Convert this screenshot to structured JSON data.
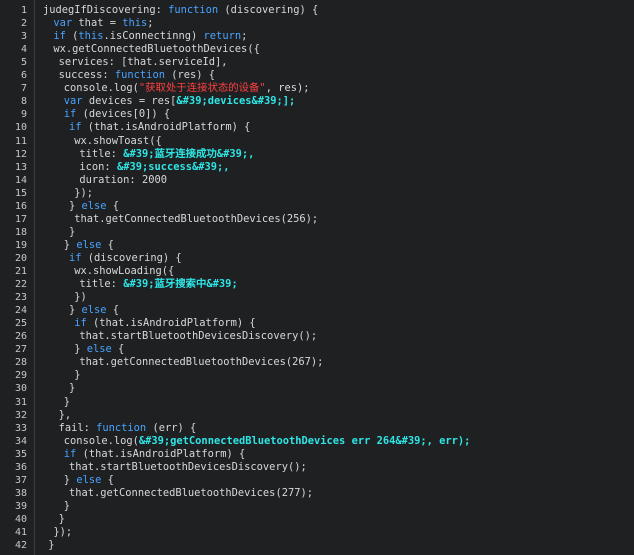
{
  "lines": [
    {
      "n": "1",
      "indent": 0,
      "parts": [
        {
          "t": "judegIfDiscovering: ",
          "c": "txt"
        },
        {
          "t": "function",
          "c": "kw"
        },
        {
          "t": " (discovering) {",
          "c": "txt"
        }
      ]
    },
    {
      "n": "2",
      "indent": 2,
      "parts": [
        {
          "t": "var",
          "c": "kw"
        },
        {
          "t": " that = ",
          "c": "txt"
        },
        {
          "t": "this",
          "c": "kw"
        },
        {
          "t": ";",
          "c": "txt"
        }
      ]
    },
    {
      "n": "3",
      "indent": 2,
      "parts": [
        {
          "t": "if",
          "c": "kw"
        },
        {
          "t": " (",
          "c": "txt"
        },
        {
          "t": "this",
          "c": "kw"
        },
        {
          "t": ".isConnectinng) ",
          "c": "txt"
        },
        {
          "t": "return",
          "c": "kw"
        },
        {
          "t": ";",
          "c": "txt"
        }
      ]
    },
    {
      "n": "4",
      "indent": 2,
      "parts": [
        {
          "t": "wx.getConnectedBluetoothDevices({",
          "c": "txt"
        }
      ]
    },
    {
      "n": "5",
      "indent": 3,
      "parts": [
        {
          "t": "services: [that.serviceId],",
          "c": "txt"
        }
      ]
    },
    {
      "n": "6",
      "indent": 3,
      "parts": [
        {
          "t": "success: ",
          "c": "txt"
        },
        {
          "t": "function",
          "c": "kw"
        },
        {
          "t": " (res) {",
          "c": "txt"
        }
      ]
    },
    {
      "n": "7",
      "indent": 4,
      "parts": [
        {
          "t": "console.log(",
          "c": "txt"
        },
        {
          "t": "\"获取处于连接状态的设备\"",
          "c": "str"
        },
        {
          "t": ", res);",
          "c": "txt"
        }
      ]
    },
    {
      "n": "8",
      "indent": 4,
      "parts": [
        {
          "t": "var",
          "c": "kw"
        },
        {
          "t": " devices = res[",
          "c": "txt"
        },
        {
          "t": "&#39;devices&#39;];",
          "c": "ent"
        }
      ]
    },
    {
      "n": "9",
      "indent": 4,
      "parts": [
        {
          "t": "if",
          "c": "kw"
        },
        {
          "t": " (devices[0]) {",
          "c": "txt"
        }
      ]
    },
    {
      "n": "10",
      "indent": 5,
      "parts": [
        {
          "t": "if",
          "c": "kw"
        },
        {
          "t": " (that.isAndroidPlatform) {",
          "c": "txt"
        }
      ]
    },
    {
      "n": "11",
      "indent": 6,
      "parts": [
        {
          "t": "wx.showToast({",
          "c": "txt"
        }
      ]
    },
    {
      "n": "12",
      "indent": 7,
      "parts": [
        {
          "t": "title: ",
          "c": "txt"
        },
        {
          "t": "&#39;蓝牙连接成功&#39;,",
          "c": "ent"
        }
      ]
    },
    {
      "n": "13",
      "indent": 7,
      "parts": [
        {
          "t": "icon: ",
          "c": "txt"
        },
        {
          "t": "&#39;success&#39;,",
          "c": "ent"
        }
      ]
    },
    {
      "n": "14",
      "indent": 7,
      "parts": [
        {
          "t": "duration: 2000",
          "c": "txt"
        }
      ]
    },
    {
      "n": "15",
      "indent": 6,
      "parts": [
        {
          "t": "});",
          "c": "txt"
        }
      ]
    },
    {
      "n": "16",
      "indent": 5,
      "parts": [
        {
          "t": "} ",
          "c": "txt"
        },
        {
          "t": "else",
          "c": "kw"
        },
        {
          "t": " {",
          "c": "txt"
        }
      ]
    },
    {
      "n": "17",
      "indent": 6,
      "parts": [
        {
          "t": "that.getConnectedBluetoothDevices(256);",
          "c": "txt"
        }
      ]
    },
    {
      "n": "18",
      "indent": 5,
      "parts": [
        {
          "t": "}",
          "c": "txt"
        }
      ]
    },
    {
      "n": "19",
      "indent": 4,
      "parts": [
        {
          "t": "} ",
          "c": "txt"
        },
        {
          "t": "else",
          "c": "kw"
        },
        {
          "t": " {",
          "c": "txt"
        }
      ]
    },
    {
      "n": "20",
      "indent": 5,
      "parts": [
        {
          "t": "if",
          "c": "kw"
        },
        {
          "t": " (discovering) {",
          "c": "txt"
        }
      ]
    },
    {
      "n": "21",
      "indent": 6,
      "parts": [
        {
          "t": "wx.showLoading({",
          "c": "txt"
        }
      ]
    },
    {
      "n": "22",
      "indent": 7,
      "parts": [
        {
          "t": "title: ",
          "c": "txt"
        },
        {
          "t": "&#39;蓝牙搜索中&#39;",
          "c": "ent"
        }
      ]
    },
    {
      "n": "23",
      "indent": 6,
      "parts": [
        {
          "t": "})",
          "c": "txt"
        }
      ]
    },
    {
      "n": "24",
      "indent": 5,
      "parts": [
        {
          "t": "} ",
          "c": "txt"
        },
        {
          "t": "else",
          "c": "kw"
        },
        {
          "t": " {",
          "c": "txt"
        }
      ]
    },
    {
      "n": "25",
      "indent": 6,
      "parts": [
        {
          "t": "if",
          "c": "kw"
        },
        {
          "t": " (that.isAndroidPlatform) {",
          "c": "txt"
        }
      ]
    },
    {
      "n": "26",
      "indent": 7,
      "parts": [
        {
          "t": "that.startBluetoothDevicesDiscovery();",
          "c": "txt"
        }
      ]
    },
    {
      "n": "27",
      "indent": 6,
      "parts": [
        {
          "t": "} ",
          "c": "txt"
        },
        {
          "t": "else",
          "c": "kw"
        },
        {
          "t": " {",
          "c": "txt"
        }
      ]
    },
    {
      "n": "28",
      "indent": 7,
      "parts": [
        {
          "t": "that.getConnectedBluetoothDevices(267);",
          "c": "txt"
        }
      ]
    },
    {
      "n": "29",
      "indent": 6,
      "parts": [
        {
          "t": "}",
          "c": "txt"
        }
      ]
    },
    {
      "n": "30",
      "indent": 5,
      "parts": [
        {
          "t": "}",
          "c": "txt"
        }
      ]
    },
    {
      "n": "31",
      "indent": 4,
      "parts": [
        {
          "t": "}",
          "c": "txt"
        }
      ]
    },
    {
      "n": "32",
      "indent": 3,
      "parts": [
        {
          "t": "},",
          "c": "txt"
        }
      ]
    },
    {
      "n": "33",
      "indent": 3,
      "parts": [
        {
          "t": "fail: ",
          "c": "txt"
        },
        {
          "t": "function",
          "c": "kw"
        },
        {
          "t": " (err) {",
          "c": "txt"
        }
      ]
    },
    {
      "n": "34",
      "indent": 4,
      "parts": [
        {
          "t": "console.log(",
          "c": "txt"
        },
        {
          "t": "&#39;getConnectedBluetoothDevices err 264&#39;, err);",
          "c": "ent"
        }
      ]
    },
    {
      "n": "35",
      "indent": 4,
      "parts": [
        {
          "t": "if",
          "c": "kw"
        },
        {
          "t": " (that.isAndroidPlatform) {",
          "c": "txt"
        }
      ]
    },
    {
      "n": "36",
      "indent": 5,
      "parts": [
        {
          "t": "that.startBluetoothDevicesDiscovery();",
          "c": "txt"
        }
      ]
    },
    {
      "n": "37",
      "indent": 4,
      "parts": [
        {
          "t": "} ",
          "c": "txt"
        },
        {
          "t": "else",
          "c": "kw"
        },
        {
          "t": " {",
          "c": "txt"
        }
      ]
    },
    {
      "n": "38",
      "indent": 5,
      "parts": [
        {
          "t": "that.getConnectedBluetoothDevices(277);",
          "c": "txt"
        }
      ]
    },
    {
      "n": "39",
      "indent": 4,
      "parts": [
        {
          "t": "}",
          "c": "txt"
        }
      ]
    },
    {
      "n": "40",
      "indent": 3,
      "parts": [
        {
          "t": "}",
          "c": "txt"
        }
      ]
    },
    {
      "n": "41",
      "indent": 2,
      "parts": [
        {
          "t": "});",
          "c": "txt"
        }
      ]
    },
    {
      "n": "42",
      "indent": 1,
      "parts": [
        {
          "t": "}",
          "c": "txt"
        }
      ]
    }
  ],
  "colors": {
    "background": "#1e2022",
    "keyword": "#4aa3ff",
    "string": "#ff4040",
    "entity": "#2ee6e6",
    "text": "#d8d8d8",
    "line_number": "#c8c8c8"
  }
}
